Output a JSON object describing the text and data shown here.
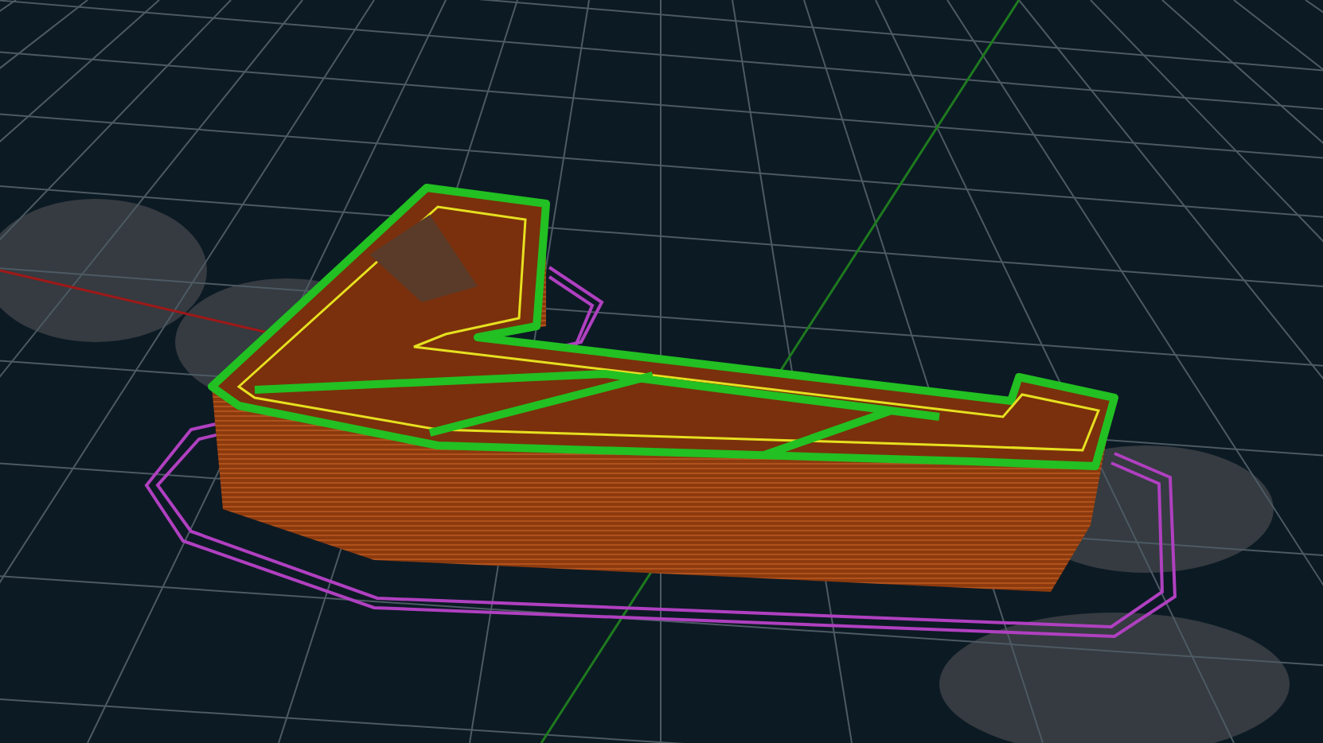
{
  "viewport": {
    "kind": "toolpath-preview"
  }
}
